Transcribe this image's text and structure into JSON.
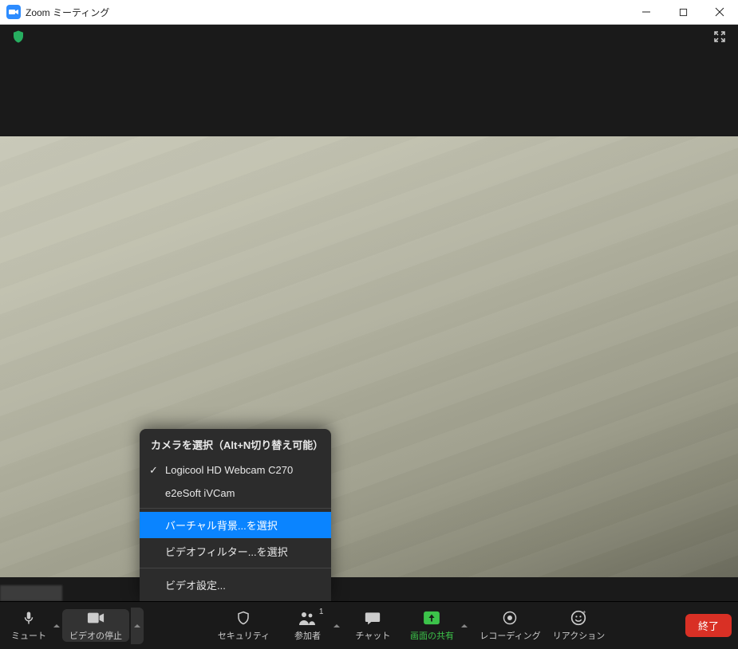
{
  "window": {
    "title": "Zoom ミーティング"
  },
  "toolbar": {
    "mute": "ミュート",
    "video": "ビデオの停止",
    "security": "セキュリティ",
    "participants": "参加者",
    "participants_count": "1",
    "chat": "チャット",
    "share": "画面の共有",
    "record": "レコーディング",
    "reactions": "リアクション",
    "end": "終了"
  },
  "popup": {
    "header": "カメラを選択（Alt+N切り替え可能）",
    "cam1": "Logicool HD Webcam C270",
    "cam2": "e2eSoft iVCam",
    "vbg": "バーチャル背景...を選択",
    "vfilter": "ビデオフィルター...を選択",
    "vsettings": "ビデオ設定..."
  }
}
